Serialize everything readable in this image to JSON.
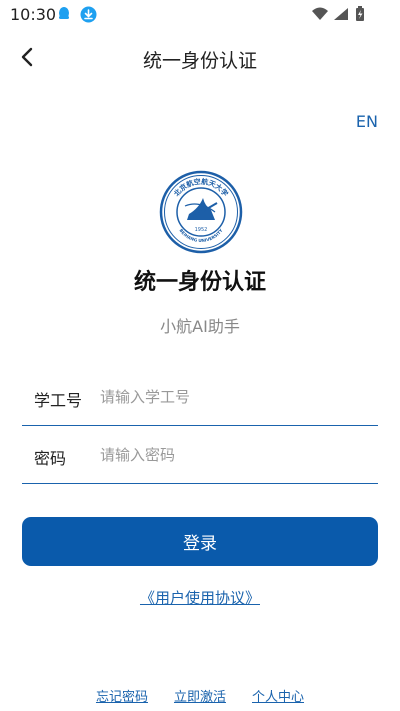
{
  "status_bar": {
    "time": "10:30",
    "icons": [
      "qq-notification-icon",
      "download-icon",
      "wifi-icon",
      "signal-icon",
      "battery-icon"
    ]
  },
  "appbar": {
    "title": "统一身份认证",
    "back_icon": "chevron-left-icon"
  },
  "lang_switch": "EN",
  "brand": {
    "logo": "university-seal-logo",
    "logo_text": {
      "top": "北京航空航天大学",
      "bottom": "BEIHANG UNIVERSITY",
      "year": "1952"
    },
    "title": "统一身份认证",
    "subtitle": "小航AI助手"
  },
  "form": {
    "id_label": "学工号",
    "id_placeholder": "请输入学工号",
    "id_value": "",
    "password_label": "密码",
    "password_placeholder": "请输入密码",
    "password_value": ""
  },
  "login_label": "登录",
  "agreement_label": "《用户使用协议》",
  "bottom_links": {
    "forgot": "忘记密码",
    "activate": "立即激活",
    "profile": "个人中心"
  },
  "colors": {
    "primary": "#0a5aab",
    "link": "#1a63ad",
    "placeholder": "#999999"
  }
}
